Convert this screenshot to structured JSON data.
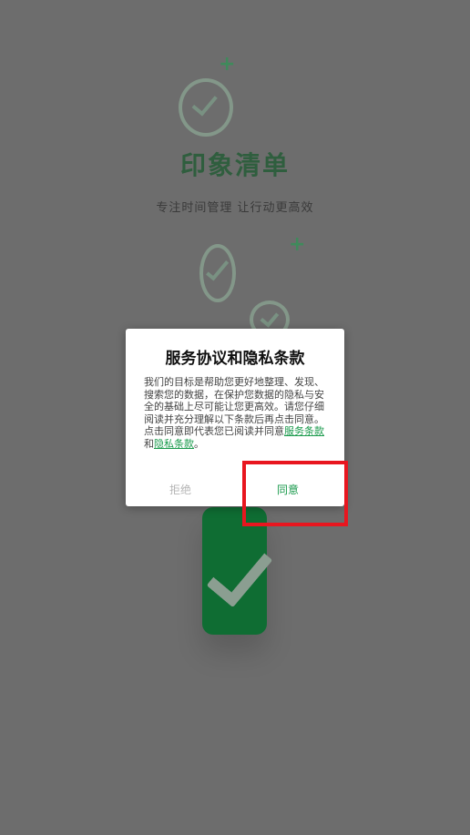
{
  "splash": {
    "title": "印象清单",
    "subtitle": "专注时间管理 让行动更高效"
  },
  "dialog": {
    "title": "服务协议和隐私条款",
    "body_main": "我们的目标是帮助您更好地整理、发现、搜索您的数据，在保护您数据的隐私与安全的基础上尽可能让您更高效。请您仔细阅读并充分理解以下条款后再点击同意。",
    "body_prefix": "点击同意即代表您已阅读并同意",
    "link_terms": "服务条款",
    "conjunction": "和",
    "link_privacy": "隐私条款",
    "body_end": "。",
    "reject_label": "拒绝",
    "agree_label": "同意"
  },
  "colors": {
    "accent_green": "#1a9a4c",
    "overlay": "#6d6d6d",
    "highlight_red": "#e8161f"
  }
}
